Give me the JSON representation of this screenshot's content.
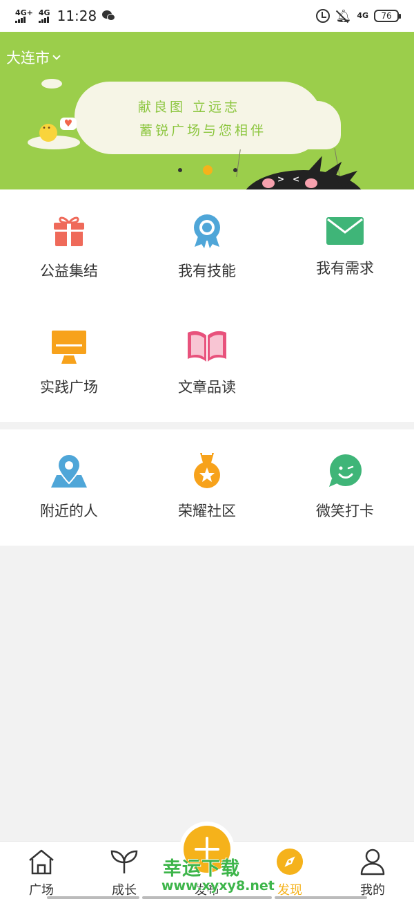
{
  "status_bar": {
    "signal_1": "4G+",
    "signal_2": "4G",
    "time": "11:28",
    "net": "4G",
    "battery": "76"
  },
  "banner": {
    "city": "大连市",
    "slogan_line1": "献良图 立远志",
    "slogan_line2": "蓄锐广场与您相伴",
    "slides": 3,
    "active_slide": 2
  },
  "grid_main": [
    {
      "label": "公益集结",
      "icon": "gift-icon",
      "color": "#ef6a5a"
    },
    {
      "label": "我有技能",
      "icon": "badge-icon",
      "color": "#4fa6d8"
    },
    {
      "label": "我有需求",
      "icon": "mail-icon",
      "color": "#3fb578"
    },
    {
      "label": "实践广场",
      "icon": "monitor-icon",
      "color": "#f7a21b"
    },
    {
      "label": "文章品读",
      "icon": "book-icon",
      "color": "#e8527c"
    }
  ],
  "grid_secondary": [
    {
      "label": "附近的人",
      "icon": "location-map-icon",
      "color": "#4fa6d8"
    },
    {
      "label": "荣耀社区",
      "icon": "medal-icon",
      "color": "#f7a21b"
    },
    {
      "label": "微笑打卡",
      "icon": "smile-chat-icon",
      "color": "#3fb578"
    }
  ],
  "bottom_nav": [
    {
      "label": "广场",
      "icon": "home-icon"
    },
    {
      "label": "成长",
      "icon": "sprout-icon"
    },
    {
      "label": "发布",
      "icon": "plus-icon"
    },
    {
      "label": "发现",
      "icon": "compass-icon"
    },
    {
      "label": "我的",
      "icon": "user-icon"
    }
  ],
  "active_tab": "发现",
  "watermark": {
    "line1": "幸运下载",
    "line2": "www.xyxy8.net"
  },
  "colors": {
    "banner_bg": "#9bce4b",
    "accent": "#f5b21b",
    "page_bg": "#f2f2f2"
  }
}
